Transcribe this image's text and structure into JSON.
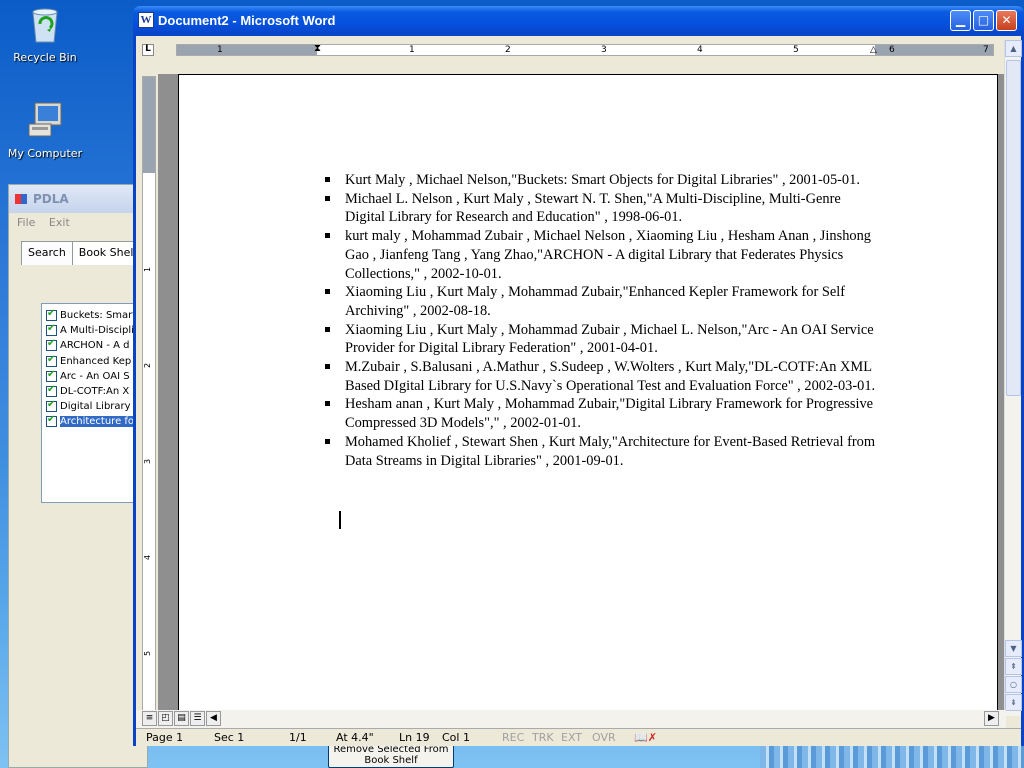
{
  "desktop": {
    "icons": [
      {
        "label": "Recycle Bin",
        "icon": "recycle-bin-icon"
      },
      {
        "label": "My Computer",
        "icon": "computer-icon"
      }
    ]
  },
  "pdla": {
    "title": "PDLA",
    "menu": [
      "File",
      "Exit"
    ],
    "tabs": [
      "Search",
      "Book Shelf"
    ],
    "items": [
      "Buckets: Smart",
      "A Multi-Discipli",
      "ARCHON - A d",
      "Enhanced Kep",
      "Arc - An OAI S",
      "DL-COTF:An X",
      "Digital Library F",
      "Architecture fo"
    ],
    "selected_index": 7,
    "remove_button": "Remove Selected From Book Shelf"
  },
  "word": {
    "title": "Document2 - Microsoft Word",
    "app_icon_letter": "W",
    "ruler_numbers": [
      "1",
      "1",
      "2",
      "3",
      "4",
      "5",
      "6",
      "7"
    ],
    "vruler_numbers": [
      "1",
      "2",
      "3",
      "4",
      "5"
    ],
    "document_items": [
      "Kurt Maly , Michael Nelson,\"Buckets: Smart Objects for Digital Libraries\" , 2001-05-01.",
      "Michael L. Nelson , Kurt Maly , Stewart N. T. Shen,\"A Multi-Discipline, Multi-Genre Digital Library for Research and Education\" , 1998-06-01.",
      "kurt maly , Mohammad Zubair , Michael Nelson , Xiaoming Liu , Hesham Anan , Jinshong Gao , Jianfeng Tang , Yang Zhao,\"ARCHON - A digital Library that Federates Physics Collections,\" , 2002-10-01.",
      "Xiaoming Liu , Kurt Maly , Mohammad Zubair,\"Enhanced Kepler Framework for Self Archiving\" , 2002-08-18.",
      "Xiaoming Liu , Kurt Maly , Mohammad Zubair , Michael L. Nelson,\"Arc - An OAI Service Provider for Digital Library Federation\" , 2001-04-01.",
      "M.Zubair , S.Balusani , A.Mathur , S.Sudeep , W.Wolters , Kurt Maly,\"DL-COTF:An XML Based DIgital Library for U.S.Navy`s Operational Test and Evaluation Force\" , 2002-03-01.",
      "Hesham anan , Kurt Maly , Mohammad Zubair,\"Digital Library Framework for Progressive Compressed 3D Models\",\" , 2002-01-01.",
      "Mohamed Kholief , Stewart Shen , Kurt Maly,\"Architecture for Event-Based Retrieval from Data Streams in Digital Libraries\" , 2001-09-01."
    ],
    "status": {
      "page": "Page 1",
      "sec": "Sec 1",
      "pages": "1/1",
      "at": "At 4.4\"",
      "ln": "Ln 19",
      "col": "Col 1",
      "rec": "REC",
      "trk": "TRK",
      "ext": "EXT",
      "ovr": "OVR"
    }
  }
}
